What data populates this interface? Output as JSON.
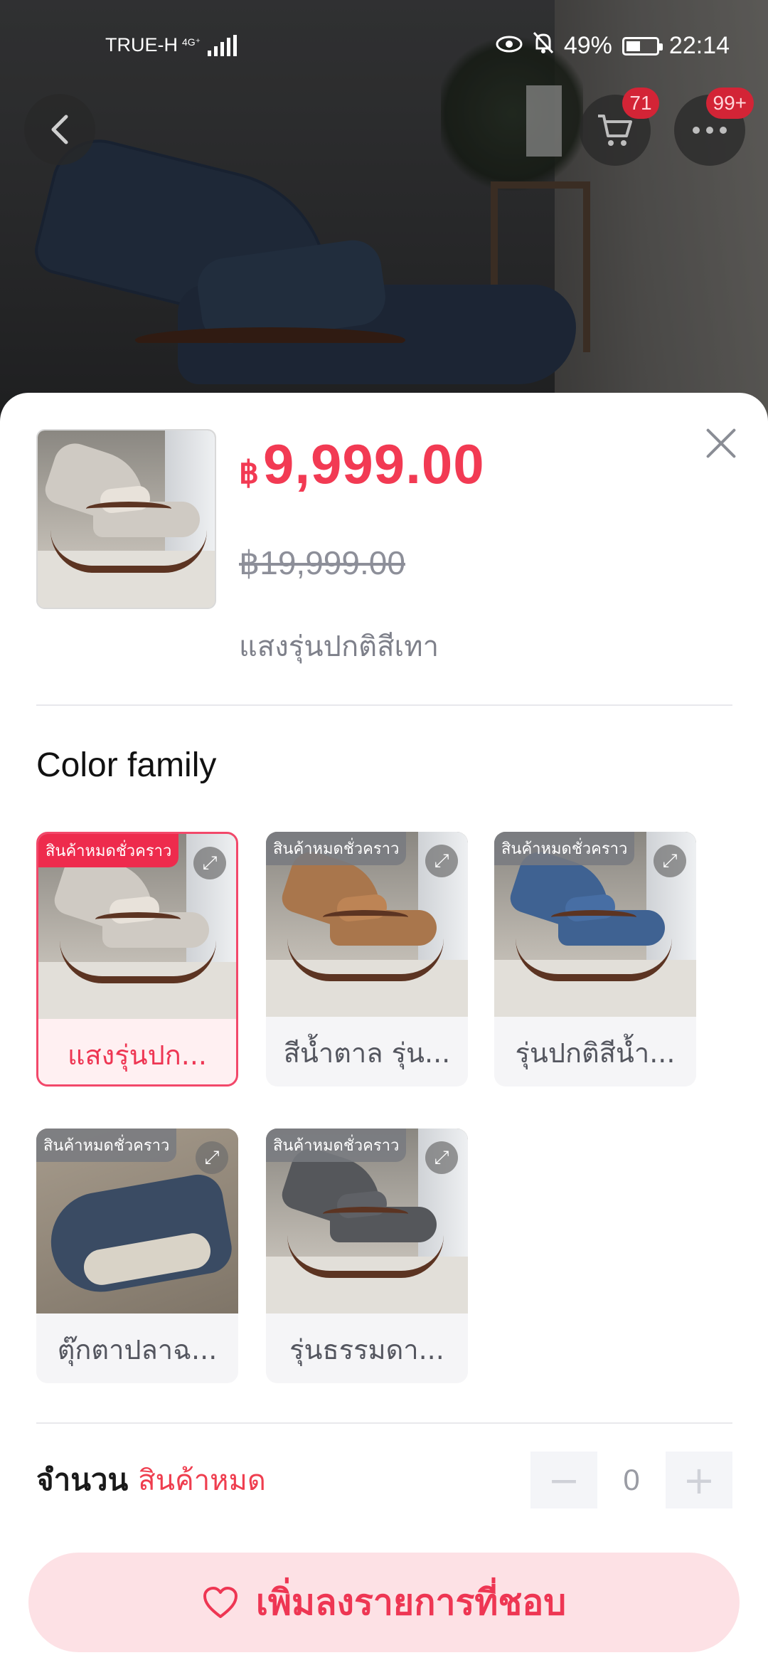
{
  "status_bar": {
    "carrier": "TRUE-H",
    "network": "4G⁺",
    "battery": "49%",
    "time": "22:14"
  },
  "header": {
    "cart_count": "71",
    "more_count": "99+"
  },
  "product": {
    "price_currency": "฿",
    "price": "9,999.00",
    "original_price": "฿19,999.00",
    "selected_variant": "แสงรุ่นปกติสีเทา"
  },
  "variants": {
    "title": "Color family",
    "items": [
      {
        "label": "แสงรุ่นปก...",
        "tag": "สินค้าหมดชั่วคราว",
        "color": "#cfcac3"
      },
      {
        "label": "สีน้ำตาล รุ่น...",
        "tag": "สินค้าหมดชั่วคราว",
        "color": "#a9764c"
      },
      {
        "label": "รุ่นปกติสีน้ำ...",
        "tag": "สินค้าหมดชั่วคราว",
        "color": "#3f6292"
      },
      {
        "label": "ตุ๊กตาปลาฉ...",
        "tag": "สินค้าหมดชั่วคราว"
      },
      {
        "label": "รุ่นธรรมดา...",
        "tag": "สินค้าหมดชั่วคราว",
        "color": "#55575b"
      }
    ]
  },
  "quantity": {
    "label": "จำนวน",
    "stock_status": "สินค้าหมด",
    "value": "0",
    "minus": "−",
    "plus": "+"
  },
  "wishlist_button": {
    "label": "เพิ่มลงรายการที่ชอบ"
  },
  "colors": {
    "accent": "#f23a53",
    "button_bg": "#fde1e5"
  }
}
